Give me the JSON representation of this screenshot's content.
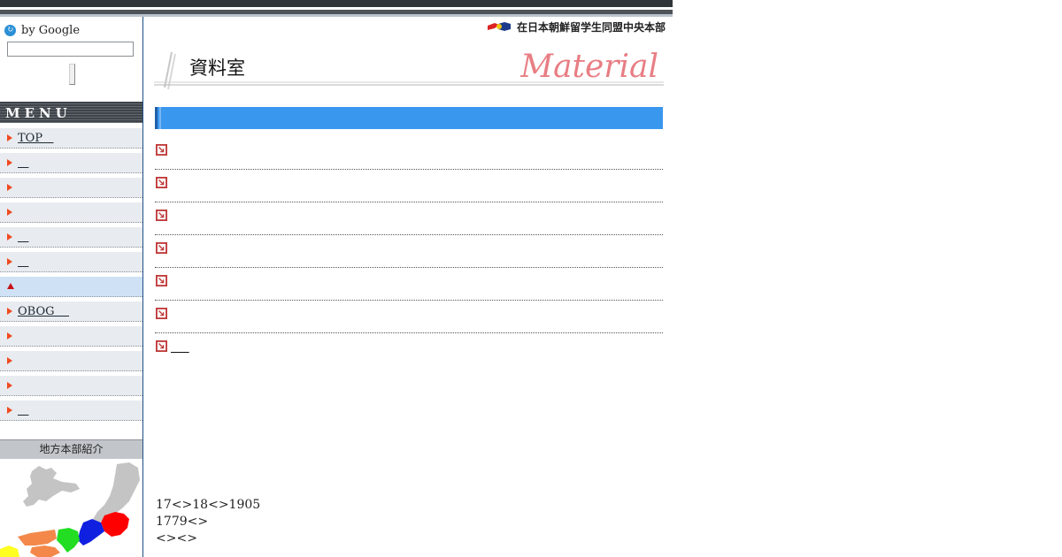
{
  "search": {
    "label": "by Google",
    "value": "",
    "placeholder": ""
  },
  "menu": {
    "header": "MENU",
    "items": [
      {
        "label": "TOP   "
      },
      {
        "label": "   "
      },
      {
        "label": ""
      },
      {
        "label": ""
      },
      {
        "label": "   "
      },
      {
        "label": "   "
      },
      {
        "label": ""
      },
      {
        "label": "OBOG    "
      },
      {
        "label": ""
      },
      {
        "label": ""
      },
      {
        "label": ""
      },
      {
        "label": "   "
      }
    ],
    "active_index": 6
  },
  "regional": {
    "header": "地方本部紹介"
  },
  "org": {
    "name": "在日本朝鮮留学生同盟中央本部"
  },
  "page": {
    "title": "資料室",
    "title_en": "Material"
  },
  "items": [
    {
      "label": ""
    },
    {
      "label": ""
    },
    {
      "label": ""
    },
    {
      "label": ""
    },
    {
      "label": ""
    },
    {
      "label": ""
    },
    {
      "label": "     "
    }
  ],
  "footer": {
    "line1": "17<>18<>1905",
    "line2": "1779<>",
    "line3": "<><>"
  },
  "colors": {
    "accent_blue": "#3a97ee",
    "menu_arrow": "#ef4b22",
    "title_en": "#e87e84"
  }
}
